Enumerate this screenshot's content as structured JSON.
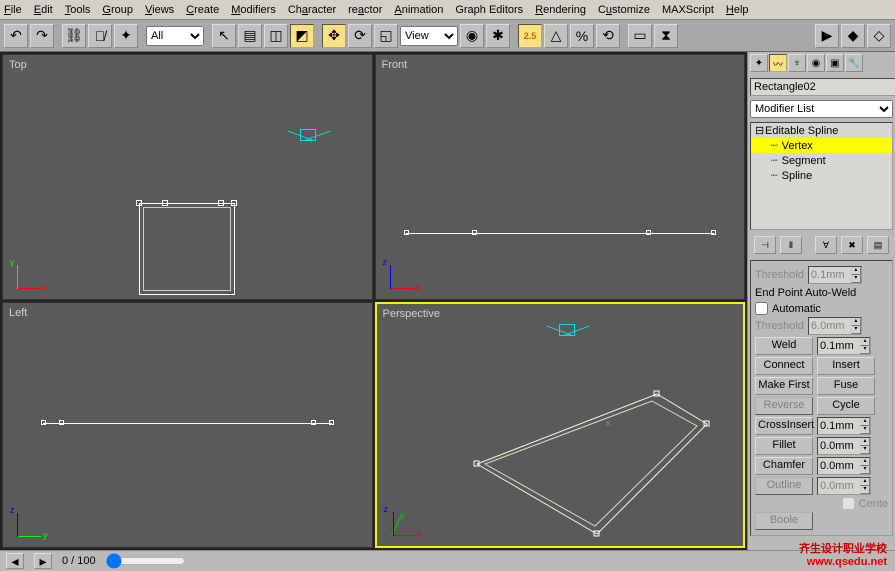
{
  "menu": {
    "items": [
      "File",
      "Edit",
      "Tools",
      "Group",
      "Views",
      "Create",
      "Modifiers",
      "Character",
      "reactor",
      "Animation",
      "Graph Editors",
      "Rendering",
      "Customize",
      "MAXScript",
      "Help"
    ]
  },
  "toolbar": {
    "filter": "All",
    "viewselect": "View"
  },
  "viewports": {
    "top": "Top",
    "front": "Front",
    "left": "Left",
    "perspective": "Perspective"
  },
  "panel": {
    "object_name": "Rectangle02",
    "modifier_dropdown": "Modifier List",
    "stack": {
      "root": "Editable Spline",
      "sub": [
        "Vertex",
        "Segment",
        "Spline"
      ]
    },
    "threshold_lbl": "Threshold",
    "threshold_top": "0.1mm",
    "endpoint": "End Point Auto-Weld",
    "automatic": "Automatic",
    "threshold2": "6.0mm",
    "weld": "Weld",
    "weld_val": "0.1mm",
    "connect": "Connect",
    "insert": "Insert",
    "makefirst": "Make First",
    "fuse": "Fuse",
    "reverse": "Reverse",
    "cycle": "Cycle",
    "crossinsert": "CrossInsert",
    "crossinsert_val": "0.1mm",
    "fillet": "Fillet",
    "fillet_val": "0.0mm",
    "chamfer": "Chamfer",
    "chamfer_val": "0.0mm",
    "outline": "Outline",
    "outline_val": "0.0mm",
    "center": "Cente",
    "boolean": "Boole"
  },
  "status": {
    "frame": "0",
    "total": "100"
  },
  "watermark": {
    "l1": "齐生设计职业学校",
    "l2": "www.qsedu.net"
  }
}
